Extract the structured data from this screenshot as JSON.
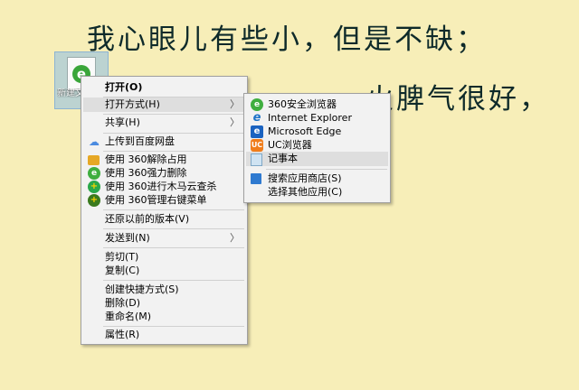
{
  "wallpaper": {
    "line1": "我心眼儿有些小，但是不缺；",
    "line2": "火脾气很好，"
  },
  "desktop_icon": {
    "label": "新建文本文档",
    "icon": "ie-document-icon"
  },
  "context_menu": {
    "items": [
      {
        "label": "打开(O)",
        "bold": true
      },
      {
        "label": "打开方式(H)",
        "submenu": true,
        "highlighted": true
      },
      {
        "label": "共享(H)",
        "submenu": true
      },
      {
        "label": "上传到百度网盘",
        "icon": "baidu-cloud-icon"
      },
      {
        "label": "使用 360解除占用",
        "icon": "360-unlock-icon"
      },
      {
        "label": "使用 360强力删除",
        "icon": "360-delete-icon"
      },
      {
        "label": "使用 360进行木马云查杀",
        "icon": "360-trojan-scan-icon"
      },
      {
        "label": "使用 360管理右键菜单",
        "icon": "360-menu-manager-icon"
      },
      {
        "label": "还原以前的版本(V)"
      },
      {
        "label": "发送到(N)",
        "submenu": true
      },
      {
        "label": "剪切(T)"
      },
      {
        "label": "复制(C)"
      },
      {
        "label": "创建快捷方式(S)"
      },
      {
        "label": "删除(D)"
      },
      {
        "label": "重命名(M)"
      },
      {
        "label": "属性(R)"
      }
    ]
  },
  "open_with_submenu": {
    "items": [
      {
        "label": "360安全浏览器",
        "icon": "360-browser-icon"
      },
      {
        "label": "Internet Explorer",
        "icon": "internet-explorer-icon"
      },
      {
        "label": "Microsoft Edge",
        "icon": "edge-icon"
      },
      {
        "label": "UC浏览器",
        "icon": "uc-browser-icon"
      },
      {
        "label": "记事本",
        "icon": "notepad-icon",
        "highlighted": true
      },
      {
        "label": "搜索应用商店(S)",
        "icon": "store-icon"
      },
      {
        "label": "选择其他应用(C)"
      }
    ]
  },
  "submenu_arrow": "〉"
}
